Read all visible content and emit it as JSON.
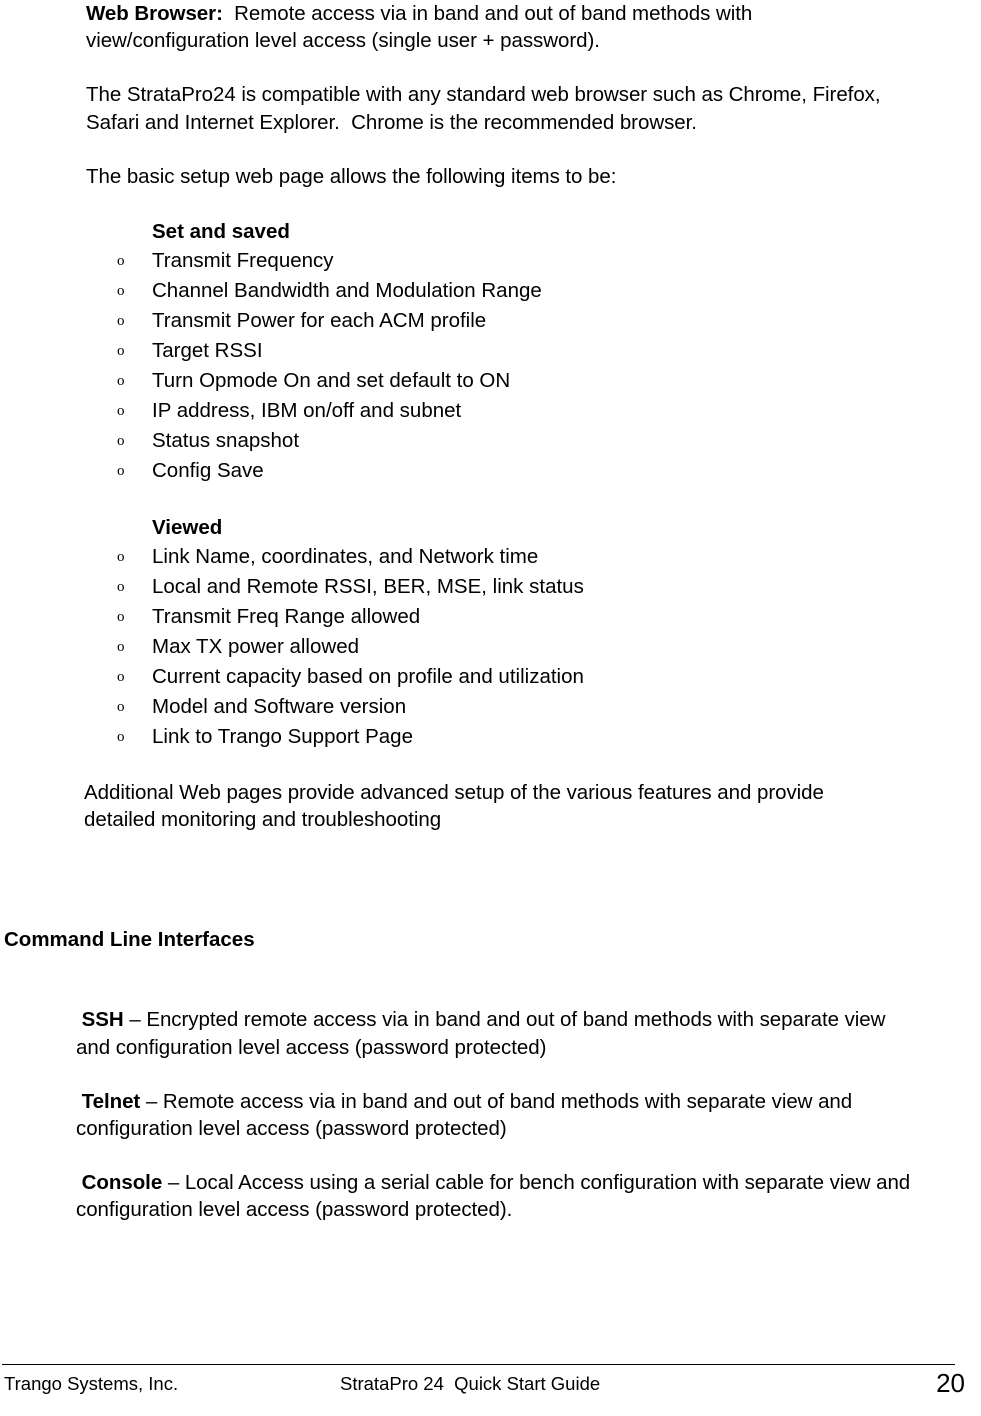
{
  "document": {
    "title": "StrataPro 24 Quick Start Guide",
    "page_number": "20"
  },
  "body": {
    "web_browser": {
      "label": "Web Browser:",
      "text": "  Remote access via in band and out of band methods with view/configuration level access (single user + password)."
    },
    "compat_paragraph": "The StrataPro24 is compatible with any standard web browser such as Chrome, Firefox, Safari and Internet Explorer.  Chrome is the recommended browser.",
    "basic_setup_intro": "The basic setup web page allows the following items to be:",
    "set_and_saved": {
      "heading": "Set and saved",
      "items": [
        "Transmit Frequency",
        "Channel Bandwidth and Modulation Range",
        "Transmit Power for each ACM profile",
        "Target RSSI",
        "Turn Opmode On and set default to ON",
        "IP address, IBM on/off and subnet",
        "Status snapshot",
        "Config Save"
      ]
    },
    "viewed": {
      "heading": "Viewed",
      "items": [
        "Link Name, coordinates, and Network time",
        "Local and Remote RSSI, BER, MSE, link status",
        "Transmit Freq Range allowed",
        "Max TX power allowed",
        "Current capacity based on profile and utilization",
        "Model and Software version",
        "Link to Trango Support Page"
      ]
    },
    "additional_web_pages": "Additional Web pages provide advanced setup of the various features and provide detailed monitoring and troubleshooting",
    "command_line_interfaces": {
      "heading": "Command Line Interfaces",
      "entries": [
        {
          "label": " SSH",
          "text": " – Encrypted remote access via in band and out of band methods with separate view and configuration level access (password protected)"
        },
        {
          "label": " Telnet",
          "text": " – Remote access via in band and out of band methods with separate view and configuration level access (password protected)"
        },
        {
          "label": " Console",
          "text": " – Local Access using a serial cable for bench configuration with separate view and configuration level access (password protected)."
        }
      ]
    }
  },
  "footer": {
    "left": "Trango Systems, Inc.",
    "center": "StrataPro 24  Quick Start Guide",
    "right": "20"
  },
  "list_marker": "o"
}
